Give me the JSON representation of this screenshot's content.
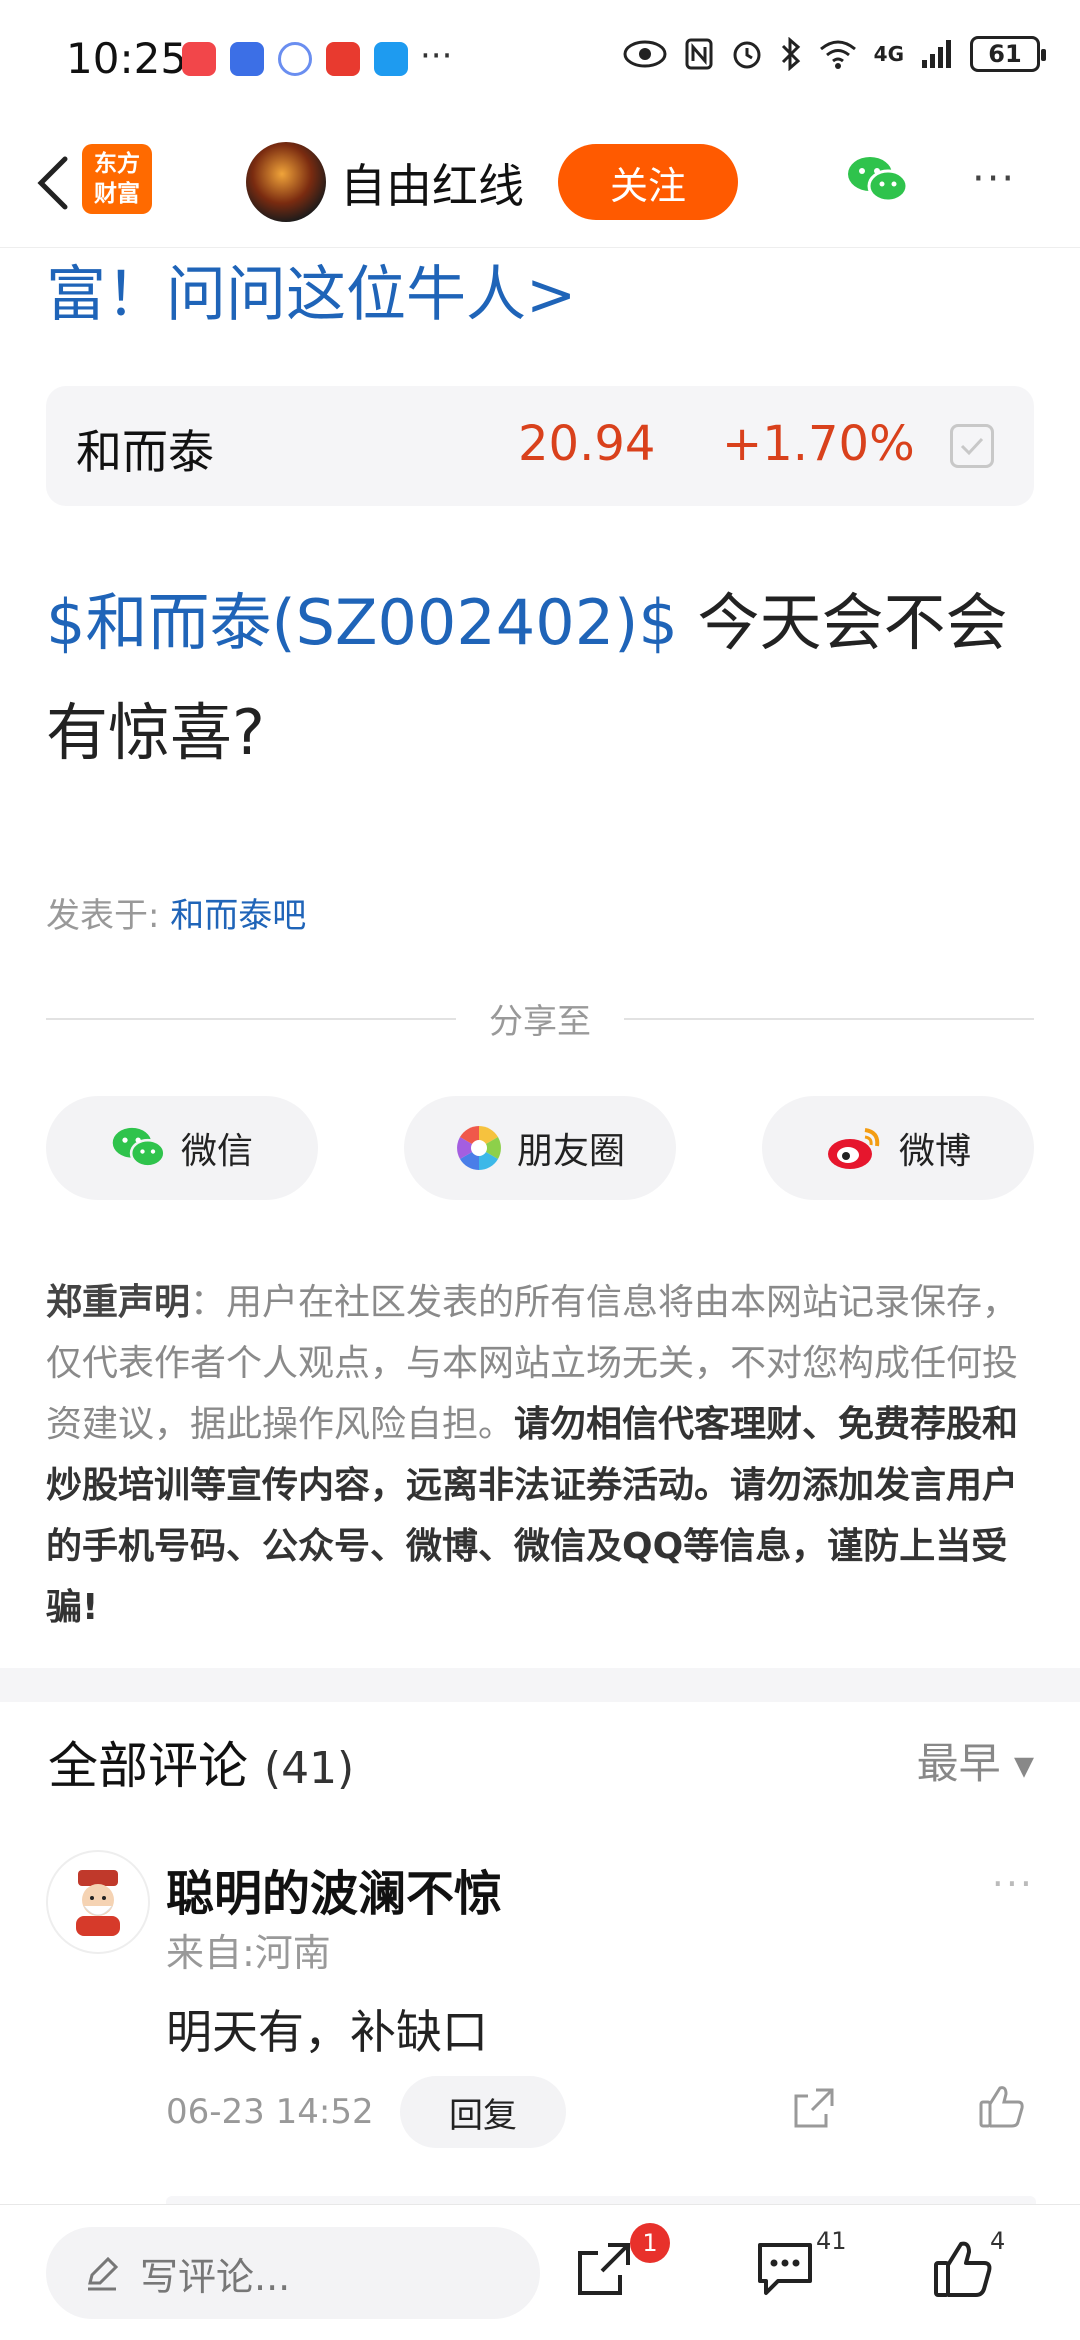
{
  "status_bar": {
    "time": "10:25",
    "more": "···",
    "battery": "61",
    "network": "4G"
  },
  "nav": {
    "brand_line1": "东方",
    "brand_line2": "财富",
    "username": "自由红线",
    "follow_label": "关注",
    "more_label": "···"
  },
  "post": {
    "title_partial": "富！问问这位牛人>",
    "stock": {
      "name": "和而泰",
      "price": "20.94",
      "change": "+1.70%"
    },
    "link_text": "$和而泰(SZ002402)$",
    "body_text": "今天会不会有惊喜?",
    "posted_in_label": "发表于:",
    "posted_in_bar": "和而泰吧"
  },
  "share": {
    "label": "分享至",
    "wechat": "微信",
    "moments": "朋友圈",
    "weibo": "微博"
  },
  "disclaimer": {
    "lead": "郑重声明",
    "colon": "：",
    "normal": "用户在社区发表的所有信息将由本网站记录保存，仅代表作者个人观点，与本网站立场无关，不对您构成任何投资建议，据此操作风险自担。",
    "strong": "请勿相信代客理财、免费荐股和炒股培训等宣传内容，远离非法证券活动。请勿添加发言用户的手机号码、公众号、微博、微信及QQ等信息，谨防上当受骗!"
  },
  "comments": {
    "title": "全部评论",
    "count": "(41)",
    "sort_label": "最早",
    "items": [
      {
        "name": "聪明的波澜不惊",
        "location": "来自:河南",
        "text": "明天有，补缺口",
        "time": "06-23 14:52",
        "reply_label": "回复"
      }
    ]
  },
  "bottom_bar": {
    "placeholder": "写评论...",
    "share_badge": "1",
    "comment_count": "41",
    "like_count": "4"
  },
  "colors": {
    "accent": "#ff5a00",
    "link": "#1f64b8",
    "price_up": "#d9411c"
  }
}
